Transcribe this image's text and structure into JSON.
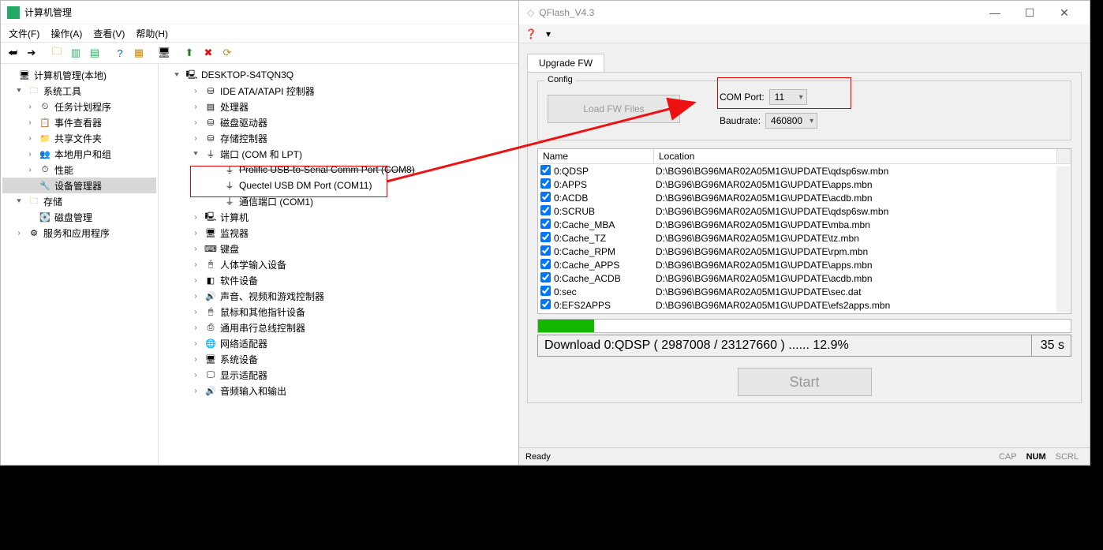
{
  "cm": {
    "title": "计算机管理",
    "menu": [
      "文件(F)",
      "操作(A)",
      "查看(V)",
      "帮助(H)"
    ],
    "left_tree": [
      {
        "ind": 0,
        "tw": "",
        "ico": "ico-mon",
        "label": "计算机管理(本地)"
      },
      {
        "ind": 1,
        "tw": "⯆",
        "ico": "ico-folder",
        "label": "系统工具"
      },
      {
        "ind": 2,
        "tw": "›",
        "ico": "ico-sched",
        "label": "任务计划程序"
      },
      {
        "ind": 2,
        "tw": "›",
        "ico": "ico-event",
        "label": "事件查看器"
      },
      {
        "ind": 2,
        "tw": "›",
        "ico": "ico-share",
        "label": "共享文件夹"
      },
      {
        "ind": 2,
        "tw": "›",
        "ico": "ico-user",
        "label": "本地用户和组"
      },
      {
        "ind": 2,
        "tw": "›",
        "ico": "ico-perf",
        "label": "性能"
      },
      {
        "ind": 2,
        "tw": "",
        "ico": "ico-devmgr",
        "label": "设备管理器",
        "sel": true
      },
      {
        "ind": 1,
        "tw": "⯆",
        "ico": "ico-folder",
        "label": "存储"
      },
      {
        "ind": 2,
        "tw": "",
        "ico": "ico-disk",
        "label": "磁盘管理"
      },
      {
        "ind": 1,
        "tw": "›",
        "ico": "ico-serv",
        "label": "服务和应用程序"
      }
    ],
    "right_tree": [
      {
        "ind": 0,
        "tw": "⯆",
        "ico": "ico-pc",
        "label": "DESKTOP-S4TQN3Q"
      },
      {
        "ind": 1,
        "tw": "›",
        "ico": "ico-drive",
        "label": "IDE ATA/ATAPI 控制器"
      },
      {
        "ind": 1,
        "tw": "›",
        "ico": "ico-chip",
        "label": "处理器"
      },
      {
        "ind": 1,
        "tw": "›",
        "ico": "ico-drive",
        "label": "磁盘驱动器"
      },
      {
        "ind": 1,
        "tw": "›",
        "ico": "ico-drive",
        "label": "存储控制器"
      },
      {
        "ind": 1,
        "tw": "⯆",
        "ico": "ico-port",
        "label": "端口 (COM 和 LPT)"
      },
      {
        "ind": 2,
        "tw": "",
        "ico": "ico-port",
        "label": "Prolific USB-to-Serial Comm Port (COM8)",
        "strike": true
      },
      {
        "ind": 2,
        "tw": "",
        "ico": "ico-port",
        "label": "Quectel USB DM Port (COM11)"
      },
      {
        "ind": 2,
        "tw": "",
        "ico": "ico-port",
        "label": "通信端口 (COM1)"
      },
      {
        "ind": 1,
        "tw": "›",
        "ico": "ico-pc",
        "label": "计算机"
      },
      {
        "ind": 1,
        "tw": "›",
        "ico": "ico-mon",
        "label": "监视器"
      },
      {
        "ind": 1,
        "tw": "›",
        "ico": "ico-kb",
        "label": "键盘"
      },
      {
        "ind": 1,
        "tw": "›",
        "ico": "ico-hid",
        "label": "人体学输入设备"
      },
      {
        "ind": 1,
        "tw": "›",
        "ico": "ico-sw",
        "label": "软件设备"
      },
      {
        "ind": 1,
        "tw": "›",
        "ico": "ico-snd",
        "label": "声音、视频和游戏控制器"
      },
      {
        "ind": 1,
        "tw": "›",
        "ico": "ico-mouse",
        "label": "鼠标和其他指针设备"
      },
      {
        "ind": 1,
        "tw": "›",
        "ico": "ico-usb",
        "label": "通用串行总线控制器"
      },
      {
        "ind": 1,
        "tw": "›",
        "ico": "ico-net",
        "label": "网络适配器"
      },
      {
        "ind": 1,
        "tw": "›",
        "ico": "ico-sys",
        "label": "系统设备"
      },
      {
        "ind": 1,
        "tw": "›",
        "ico": "ico-disp",
        "label": "显示适配器"
      },
      {
        "ind": 1,
        "tw": "›",
        "ico": "ico-snd",
        "label": "音频输入和输出"
      }
    ]
  },
  "qf": {
    "title": "QFlash_V4.3",
    "tab": "Upgrade FW",
    "config_label": "Config",
    "load_btn": "Load FW Files",
    "comport_label": "COM Port:",
    "comport_value": "11",
    "baud_label": "Baudrate:",
    "baud_value": "460800",
    "list_headers": {
      "name": "Name",
      "location": "Location"
    },
    "list": [
      {
        "chk": true,
        "name": "0:QDSP",
        "loc": "D:\\BG96\\BG96MAR02A05M1G\\UPDATE\\qdsp6sw.mbn"
      },
      {
        "chk": true,
        "name": "0:APPS",
        "loc": "D:\\BG96\\BG96MAR02A05M1G\\UPDATE\\apps.mbn"
      },
      {
        "chk": true,
        "name": "0:ACDB",
        "loc": "D:\\BG96\\BG96MAR02A05M1G\\UPDATE\\acdb.mbn"
      },
      {
        "chk": true,
        "name": "0:SCRUB",
        "loc": "D:\\BG96\\BG96MAR02A05M1G\\UPDATE\\qdsp6sw.mbn"
      },
      {
        "chk": true,
        "name": "0:Cache_MBA",
        "loc": "D:\\BG96\\BG96MAR02A05M1G\\UPDATE\\mba.mbn"
      },
      {
        "chk": true,
        "name": "0:Cache_TZ",
        "loc": "D:\\BG96\\BG96MAR02A05M1G\\UPDATE\\tz.mbn"
      },
      {
        "chk": true,
        "name": "0:Cache_RPM",
        "loc": "D:\\BG96\\BG96MAR02A05M1G\\UPDATE\\rpm.mbn"
      },
      {
        "chk": true,
        "name": "0:Cache_APPS",
        "loc": "D:\\BG96\\BG96MAR02A05M1G\\UPDATE\\apps.mbn"
      },
      {
        "chk": true,
        "name": "0:Cache_ACDB",
        "loc": "D:\\BG96\\BG96MAR02A05M1G\\UPDATE\\acdb.mbn"
      },
      {
        "chk": true,
        "name": "0:sec",
        "loc": "D:\\BG96\\BG96MAR02A05M1G\\UPDATE\\sec.dat"
      },
      {
        "chk": true,
        "name": "0:EFS2APPS",
        "loc": "D:\\BG96\\BG96MAR02A05M1G\\UPDATE\\efs2apps.mbn"
      }
    ],
    "progress_pct": 10.5,
    "status_text": "Download 0:QDSP ( 2987008 / 23127660 ) ...... 12.9%",
    "status_time": "35 s",
    "start_btn": "Start",
    "ready": "Ready",
    "indicators": {
      "cap": "CAP",
      "num": "NUM",
      "scrl": "SCRL"
    }
  }
}
